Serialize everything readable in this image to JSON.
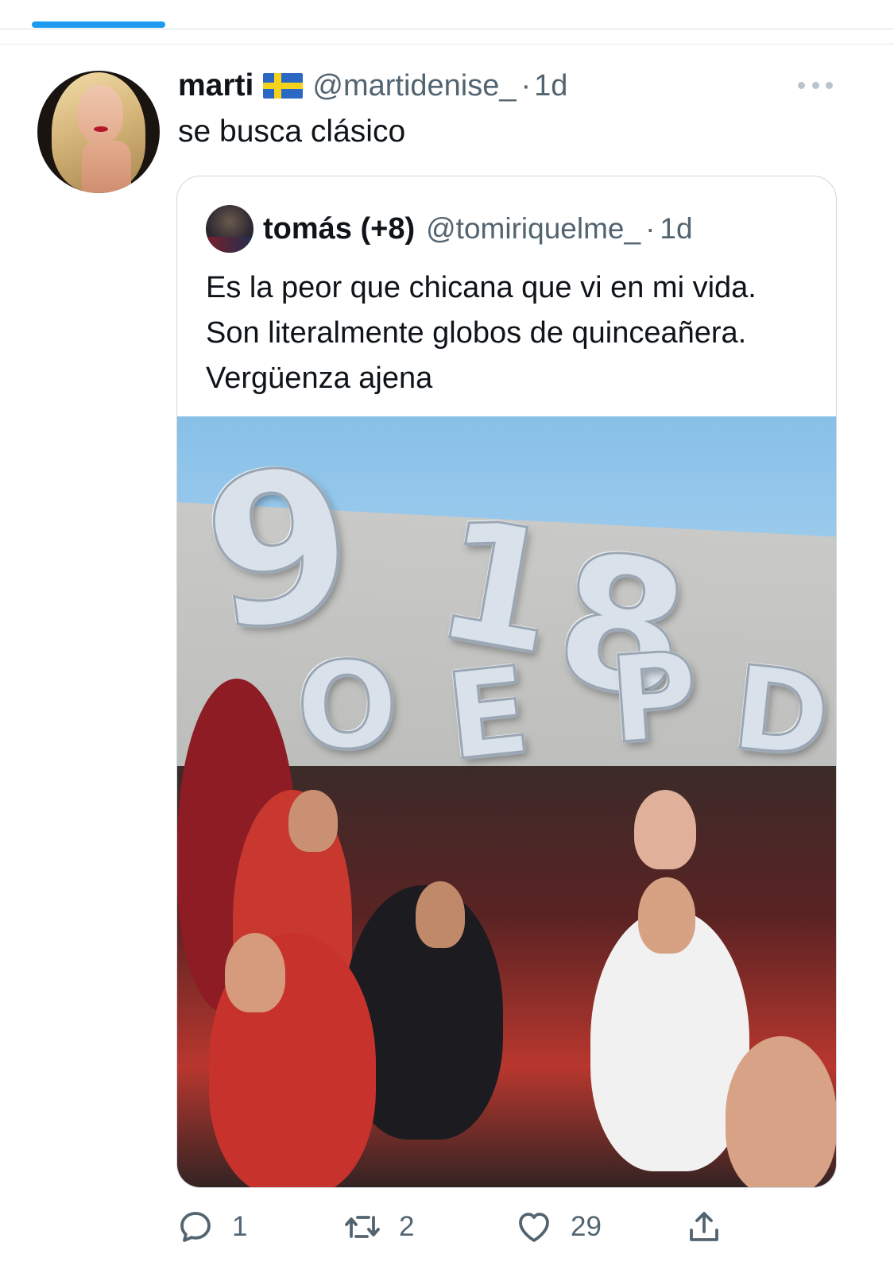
{
  "tweet": {
    "author_name": "marti",
    "author_flag": "sweden-flag",
    "author_handle": "@martidenise_",
    "separator": "·",
    "time": "1d",
    "text": "se busca clásico"
  },
  "quoted_tweet": {
    "author_name": "tomás (+8)",
    "author_handle": "@tomiriquelme_",
    "separator": "·",
    "time": "1d",
    "text": "Es la peor que chicana que vi en mi vida. Son literalmente globos de quinceañera. Vergüenza ajena",
    "media": {
      "type": "photo",
      "balloon_letters": [
        "9",
        "O",
        "1",
        "E",
        "8",
        "P",
        "D"
      ]
    }
  },
  "actions": {
    "reply_count": "1",
    "retweet_count": "2",
    "like_count": "29"
  },
  "icons": {
    "more": "more-horizontal-icon",
    "reply": "reply-icon",
    "retweet": "retweet-icon",
    "like": "heart-icon",
    "share": "share-icon"
  },
  "colors": {
    "accent": "#1d9bf0",
    "secondary_text": "#536471",
    "primary_text": "#0f1419",
    "border": "#cfd9de"
  }
}
